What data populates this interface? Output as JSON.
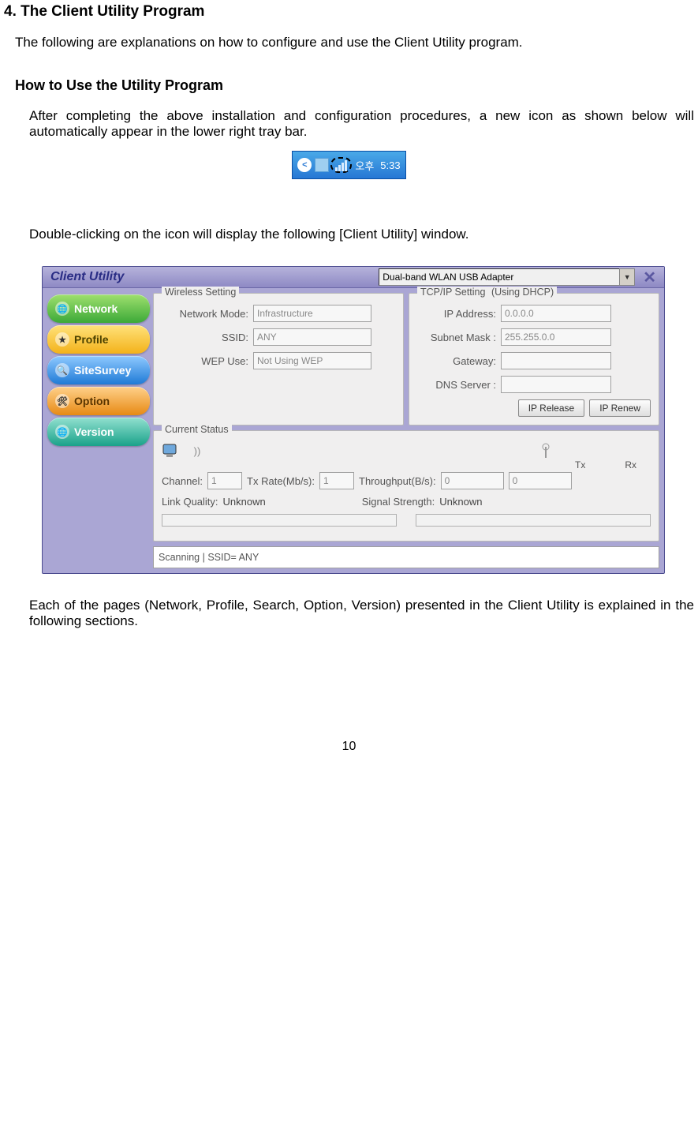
{
  "doc": {
    "section_title": "4. The Client Utility Program",
    "intro": "The following are explanations on how to configure and use the Client Utility program.",
    "subsection_title": "How to Use the Utility Program",
    "para1": "After completing the above installation and configuration procedures, a new icon as shown below will automatically appear in the lower right tray bar.",
    "para2": "Double-clicking on the icon will display the following [Client Utility] window.",
    "para3": "Each of the pages (Network, Profile, Search, Option, Version) presented in the Client Utility is explained in the following sections.",
    "page_number": "10"
  },
  "tray": {
    "meridiem": "오후",
    "time": "5:33"
  },
  "util": {
    "title": "Client Utility",
    "adapter_selected": "Dual-band WLAN USB Adapter",
    "nav": {
      "network": "Network",
      "profile": "Profile",
      "sitesurvey": "SiteSurvey",
      "option": "Option",
      "version": "Version"
    },
    "wireless": {
      "legend": "Wireless Setting",
      "nm_label": "Network Mode:",
      "nm_value": "Infrastructure",
      "ssid_label": "SSID:",
      "ssid_value": "ANY",
      "wep_label": "WEP Use:",
      "wep_value": "Not Using WEP"
    },
    "tcpip": {
      "legend": "TCP/IP Setting",
      "legend_extra": "(Using DHCP)",
      "ip_label": "IP Address:",
      "ip_value": "0.0.0.0",
      "mask_label": "Subnet Mask :",
      "mask_value": "255.255.0.0",
      "gw_label": "Gateway:",
      "gw_value": "",
      "dns_label": "DNS Server :",
      "dns_value": "",
      "release_btn": "IP Release",
      "renew_btn": "IP Renew"
    },
    "status": {
      "legend": "Current Status",
      "tx_head": "Tx",
      "rx_head": "Rx",
      "channel_label": "Channel:",
      "channel_value": "1",
      "txrate_label": "Tx Rate(Mb/s):",
      "txrate_value": "1",
      "throughput_label": "Throughput(B/s):",
      "throughput_tx": "0",
      "throughput_rx": "0",
      "linkq_label": "Link Quality:",
      "linkq_value": "Unknown",
      "sig_label": "Signal Strength:",
      "sig_value": "Unknown",
      "status_line": "Scanning | SSID= ANY"
    }
  }
}
